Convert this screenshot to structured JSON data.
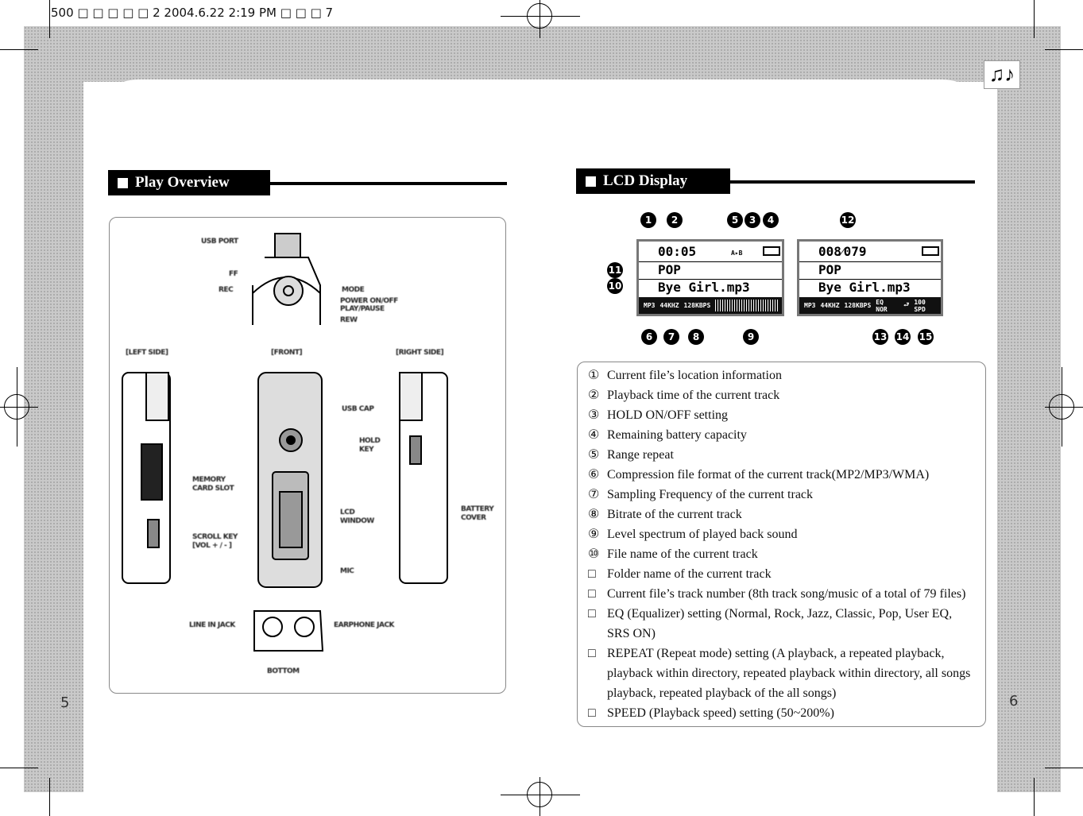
{
  "slug": "500 □ □  □ □ □ 2  2004.6.22 2:19 PM  □ □ □ 7",
  "left": {
    "title": "Play Overview",
    "page": "5",
    "labels": {
      "usb_port": "USB PORT",
      "ff": "FF",
      "rec": "REC",
      "mode": "MODE",
      "power": "POWER ON/OFF",
      "play": "PLAY/PAUSE",
      "rew": "REW",
      "left_side": "[LEFT SIDE]",
      "front": "[FRONT]",
      "right_side": "[RIGHT SIDE]",
      "usb_cap": "USB CAP",
      "hold": "HOLD",
      "hold2": "KEY",
      "card": "MEMORY",
      "card2": "CARD SLOT",
      "scroll": "SCROLL KEY",
      "scroll2": "[VOL + / - ]",
      "lcd": "LCD",
      "lcd2": "WINDOW",
      "mic": "MIC",
      "battery": "BATTERY",
      "battery2": "COVER",
      "line_in": "LINE IN JACK",
      "earphone": "EARPHONE JACK",
      "bottom": "BOTTOM"
    }
  },
  "right": {
    "title": "LCD Display",
    "page": "6",
    "lcd1": {
      "time": "00:05",
      "ab": "A▸B",
      "folder": "POP",
      "file": "Bye Girl.mp3",
      "fmt": "MP3",
      "freq": "44KHZ",
      "rate": "128KBPS"
    },
    "lcd2": {
      "track": "008⁄079",
      "folder": "POP",
      "file": "Bye Girl.mp3",
      "fmt": "MP3",
      "freq": "44KHZ",
      "rate": "128KBPS",
      "eq": "EQ NOR",
      "spd": "100 SPD"
    },
    "callouts": [
      "1",
      "2",
      "5",
      "3",
      "4",
      "12",
      "11",
      "10",
      "6",
      "7",
      "8",
      "9",
      "13",
      "14",
      "15"
    ],
    "items": [
      {
        "n": "①",
        "t": "Current file’s location information"
      },
      {
        "n": "②",
        "t": "Playback time of the current track"
      },
      {
        "n": "③",
        "t": "HOLD ON/OFF setting"
      },
      {
        "n": "④",
        "t": "Remaining battery capacity"
      },
      {
        "n": "⑤",
        "t": "Range repeat"
      },
      {
        "n": "⑥",
        "t": "Compression file format of the current track(MP2/MP3/WMA)"
      },
      {
        "n": "⑦",
        "t": "Sampling Frequency of the current track"
      },
      {
        "n": "⑧",
        "t": "Bitrate of the current track"
      },
      {
        "n": "⑨",
        "t": "Level spectrum of played back sound"
      },
      {
        "n": "⑩",
        "t": "File name of the current track"
      },
      {
        "n": "□",
        "t": "Folder name of the current track"
      },
      {
        "n": "□",
        "t": "Current file’s track number (8th track song/music of a total of 79 files)"
      },
      {
        "n": "□",
        "t": "EQ (Equalizer) setting (Normal, Rock, Jazz, Classic, Pop, User EQ, SRS ON)"
      },
      {
        "n": "□",
        "t": "REPEAT (Repeat mode) setting (A playback, a repeated playback, playback within directory, repeated playback within directory, all songs playback, repeated playback of the all songs)"
      },
      {
        "n": "□",
        "t": "SPEED (Playback speed) setting (50~200%)"
      }
    ]
  }
}
